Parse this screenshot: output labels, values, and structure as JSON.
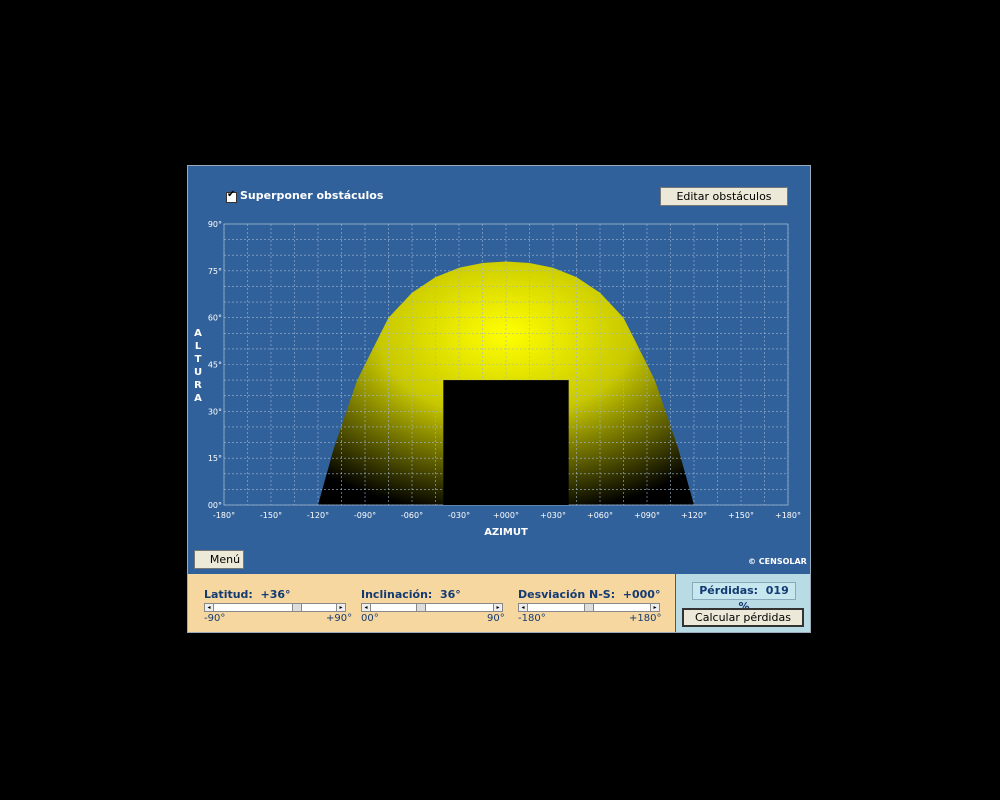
{
  "header": {
    "overlay_checkbox_label": "Superponer obstáculos",
    "overlay_checked": true,
    "edit_button_label": "Editar obstáculos"
  },
  "chart": {
    "ylabel": "ALTURA",
    "xlabel": "AZIMUT",
    "y_ticks": [
      "90°",
      "75°",
      "60°",
      "45°",
      "30°",
      "15°",
      "00°"
    ],
    "x_ticks": [
      "-180°",
      "-150°",
      "-120°",
      "-090°",
      "-060°",
      "-030°",
      "+000°",
      "+030°",
      "+060°",
      "+090°",
      "+120°",
      "+150°",
      "+180°"
    ]
  },
  "chart_data": {
    "type": "area",
    "xlim": [
      -180,
      180
    ],
    "ylim": [
      0,
      90
    ],
    "grid": true,
    "sun_path_envelope": {
      "x": [
        -120,
        -110,
        -95,
        -85,
        -75,
        -60,
        -45,
        -30,
        -15,
        0,
        15,
        30,
        45,
        60,
        75,
        85,
        95,
        110,
        120
      ],
      "y": [
        0,
        18,
        40,
        50,
        60,
        68,
        73,
        76,
        77.5,
        78,
        77.5,
        76,
        73,
        68,
        60,
        50,
        40,
        18,
        0
      ]
    },
    "obstacle": {
      "azimuth_range": [
        -40,
        40
      ],
      "altitude_range": [
        0,
        40
      ]
    },
    "colors": {
      "sun_path": "#ffff00",
      "obstacle": "#000000",
      "background": "#31619a"
    }
  },
  "footer": {
    "menu_label": "Menú",
    "credit": "© CENSOLAR"
  },
  "controls": {
    "latitude": {
      "label": "Latitud:",
      "value": "+36°",
      "min": "-90°",
      "max": "+90°",
      "fraction": 0.7
    },
    "inclination": {
      "label": "Inclinación:",
      "value": "36°",
      "min": "00°",
      "max": "90°",
      "fraction": 0.4
    },
    "deviation": {
      "label": "Desviación N-S:",
      "value": "+000°",
      "min": "-180°",
      "max": "+180°",
      "fraction": 0.5
    }
  },
  "result": {
    "loss_label": "Pérdidas:",
    "loss_value": "019 %",
    "calculate_button_label": "Calcular pérdidas"
  }
}
